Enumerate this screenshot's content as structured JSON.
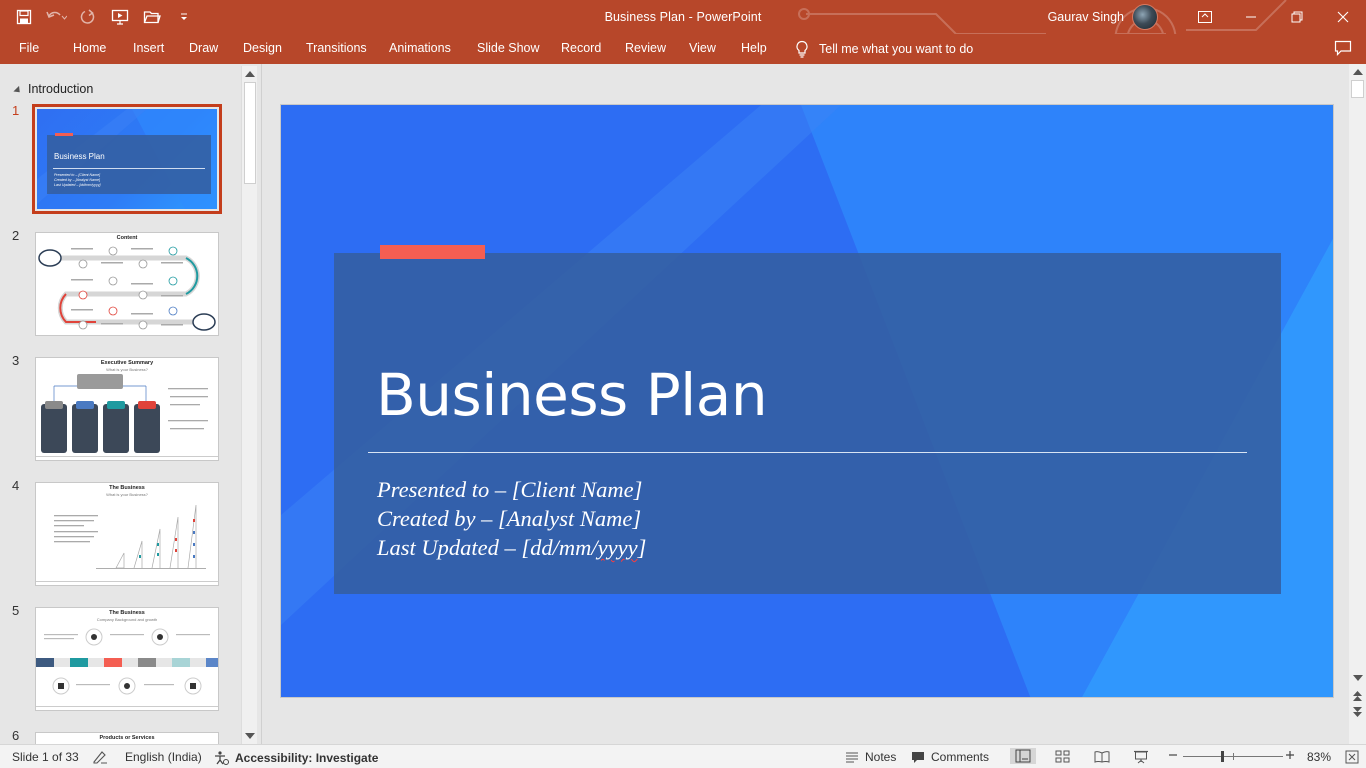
{
  "app": {
    "document_title": "Business Plan",
    "separator": " - ",
    "app_name": "PowerPoint",
    "user_name": "Gaurav Singh"
  },
  "qat": {
    "icons": [
      "save-icon",
      "undo-icon",
      "redo-icon",
      "present-from-beginning-icon",
      "open-icon",
      "customize-qat-icon"
    ]
  },
  "ribbon": {
    "tabs": [
      "File",
      "Home",
      "Insert",
      "Draw",
      "Design",
      "Transitions",
      "Animations",
      "Slide Show",
      "Record",
      "Review",
      "View",
      "Help"
    ],
    "tell_me": "Tell me what you want to do"
  },
  "thumbnails": {
    "section_name": "Introduction",
    "slide_numbers": [
      "1",
      "2",
      "3",
      "4",
      "5",
      "6"
    ],
    "slide1": {
      "title": "Business Plan",
      "lines": [
        "Presented to – [Client Name]",
        "Created by – [Analyst Name]",
        "Last Updated – [dd/mm/yyyy]"
      ]
    },
    "slide2": {
      "title": "Content"
    },
    "slide3": {
      "title": "Executive Summary",
      "subtitle": "What is your Business?"
    },
    "slide4": {
      "title": "The Business",
      "subtitle": "What is your Business?"
    },
    "slide5": {
      "title": "The Business",
      "subtitle": "Company Background and growth"
    },
    "slide6": {
      "title": "Products or Services"
    }
  },
  "slide": {
    "title": "Business Plan",
    "line1": "Presented to – [Client Name]",
    "line2": "Created by – [Analyst Name]",
    "line3_prefix": "Last Updated – [dd/mm/",
    "line3_flagged": "yyyy",
    "line3_suffix": "]",
    "colors": {
      "background": "#2d6df3",
      "banner": "#345fa0",
      "accent_bar": "#f45e52",
      "ribbon": "#b7472a"
    }
  },
  "status_bar": {
    "slide_info": "Slide 1 of 33",
    "language": "English (India)",
    "accessibility": "Accessibility: Investigate",
    "notes": "Notes",
    "comments": "Comments",
    "zoom": "83%"
  }
}
